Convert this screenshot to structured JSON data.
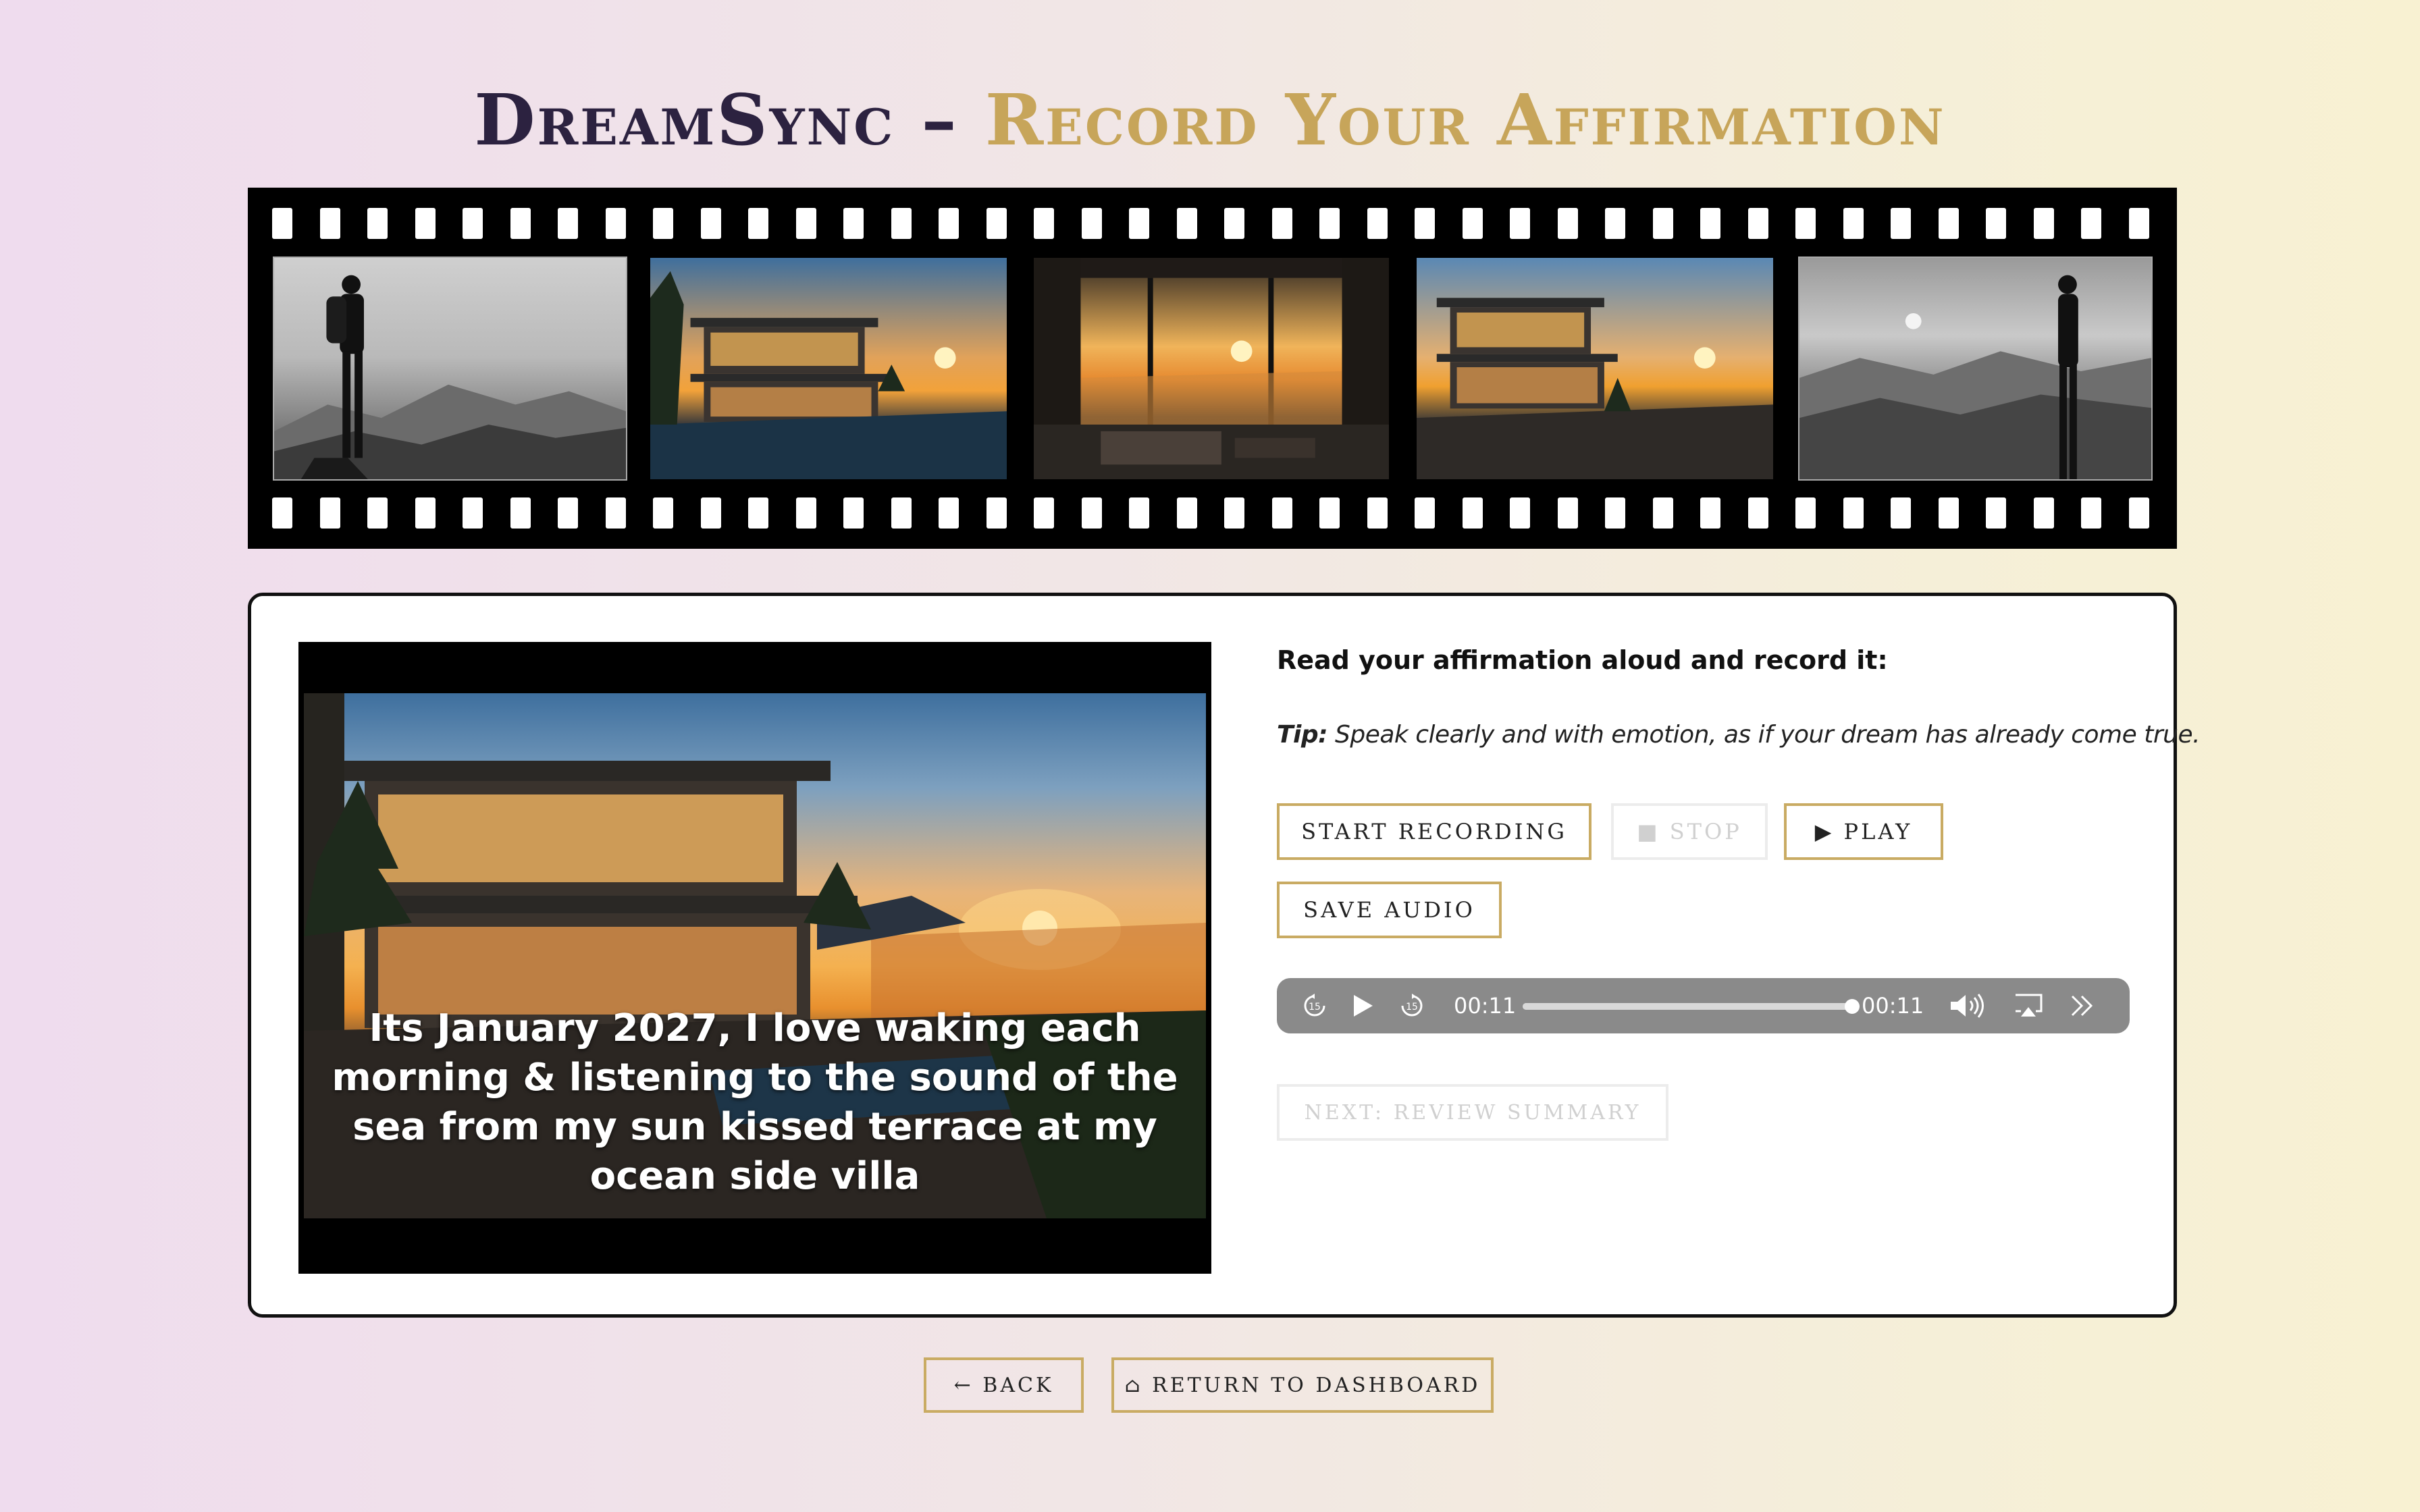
{
  "header": {
    "brand": "DreamSync",
    "separator": "–",
    "subtitle": "Record Your Affirmation"
  },
  "filmstrip": {
    "frames": [
      {
        "name": "hiker-silhouette-mountains"
      },
      {
        "name": "villa-sunset-pool"
      },
      {
        "name": "villa-interior-sea-view"
      },
      {
        "name": "villa-sunset-terrace"
      },
      {
        "name": "woman-silhouette-mountains"
      }
    ]
  },
  "video": {
    "caption": "Its January 2027, I love waking each morning & listening to the sound of the sea from my sun kissed terrace at my ocean side villa"
  },
  "record": {
    "instruction": "Read your affirmation aloud and record it:",
    "tip_label": "Tip:",
    "tip_text": " Speak clearly and with emotion, as if your dream has already come true.",
    "start_label": "Start Recording",
    "stop_label": "■ Stop",
    "play_label": "▶ Play",
    "save_label": "Save Audio",
    "next_label": "Next: Review Summary"
  },
  "audio_player": {
    "current_time": "00:11",
    "duration": "00:11",
    "progress": 1.0,
    "skip_back_seconds": "15",
    "skip_forward_seconds": "15"
  },
  "nav": {
    "back_label": "← Back",
    "dashboard_label": "⌂ Return to Dashboard"
  },
  "colors": {
    "accent_gold": "#c9ab63",
    "title_dark": "#2c2240",
    "title_gold": "#c7a55a"
  }
}
